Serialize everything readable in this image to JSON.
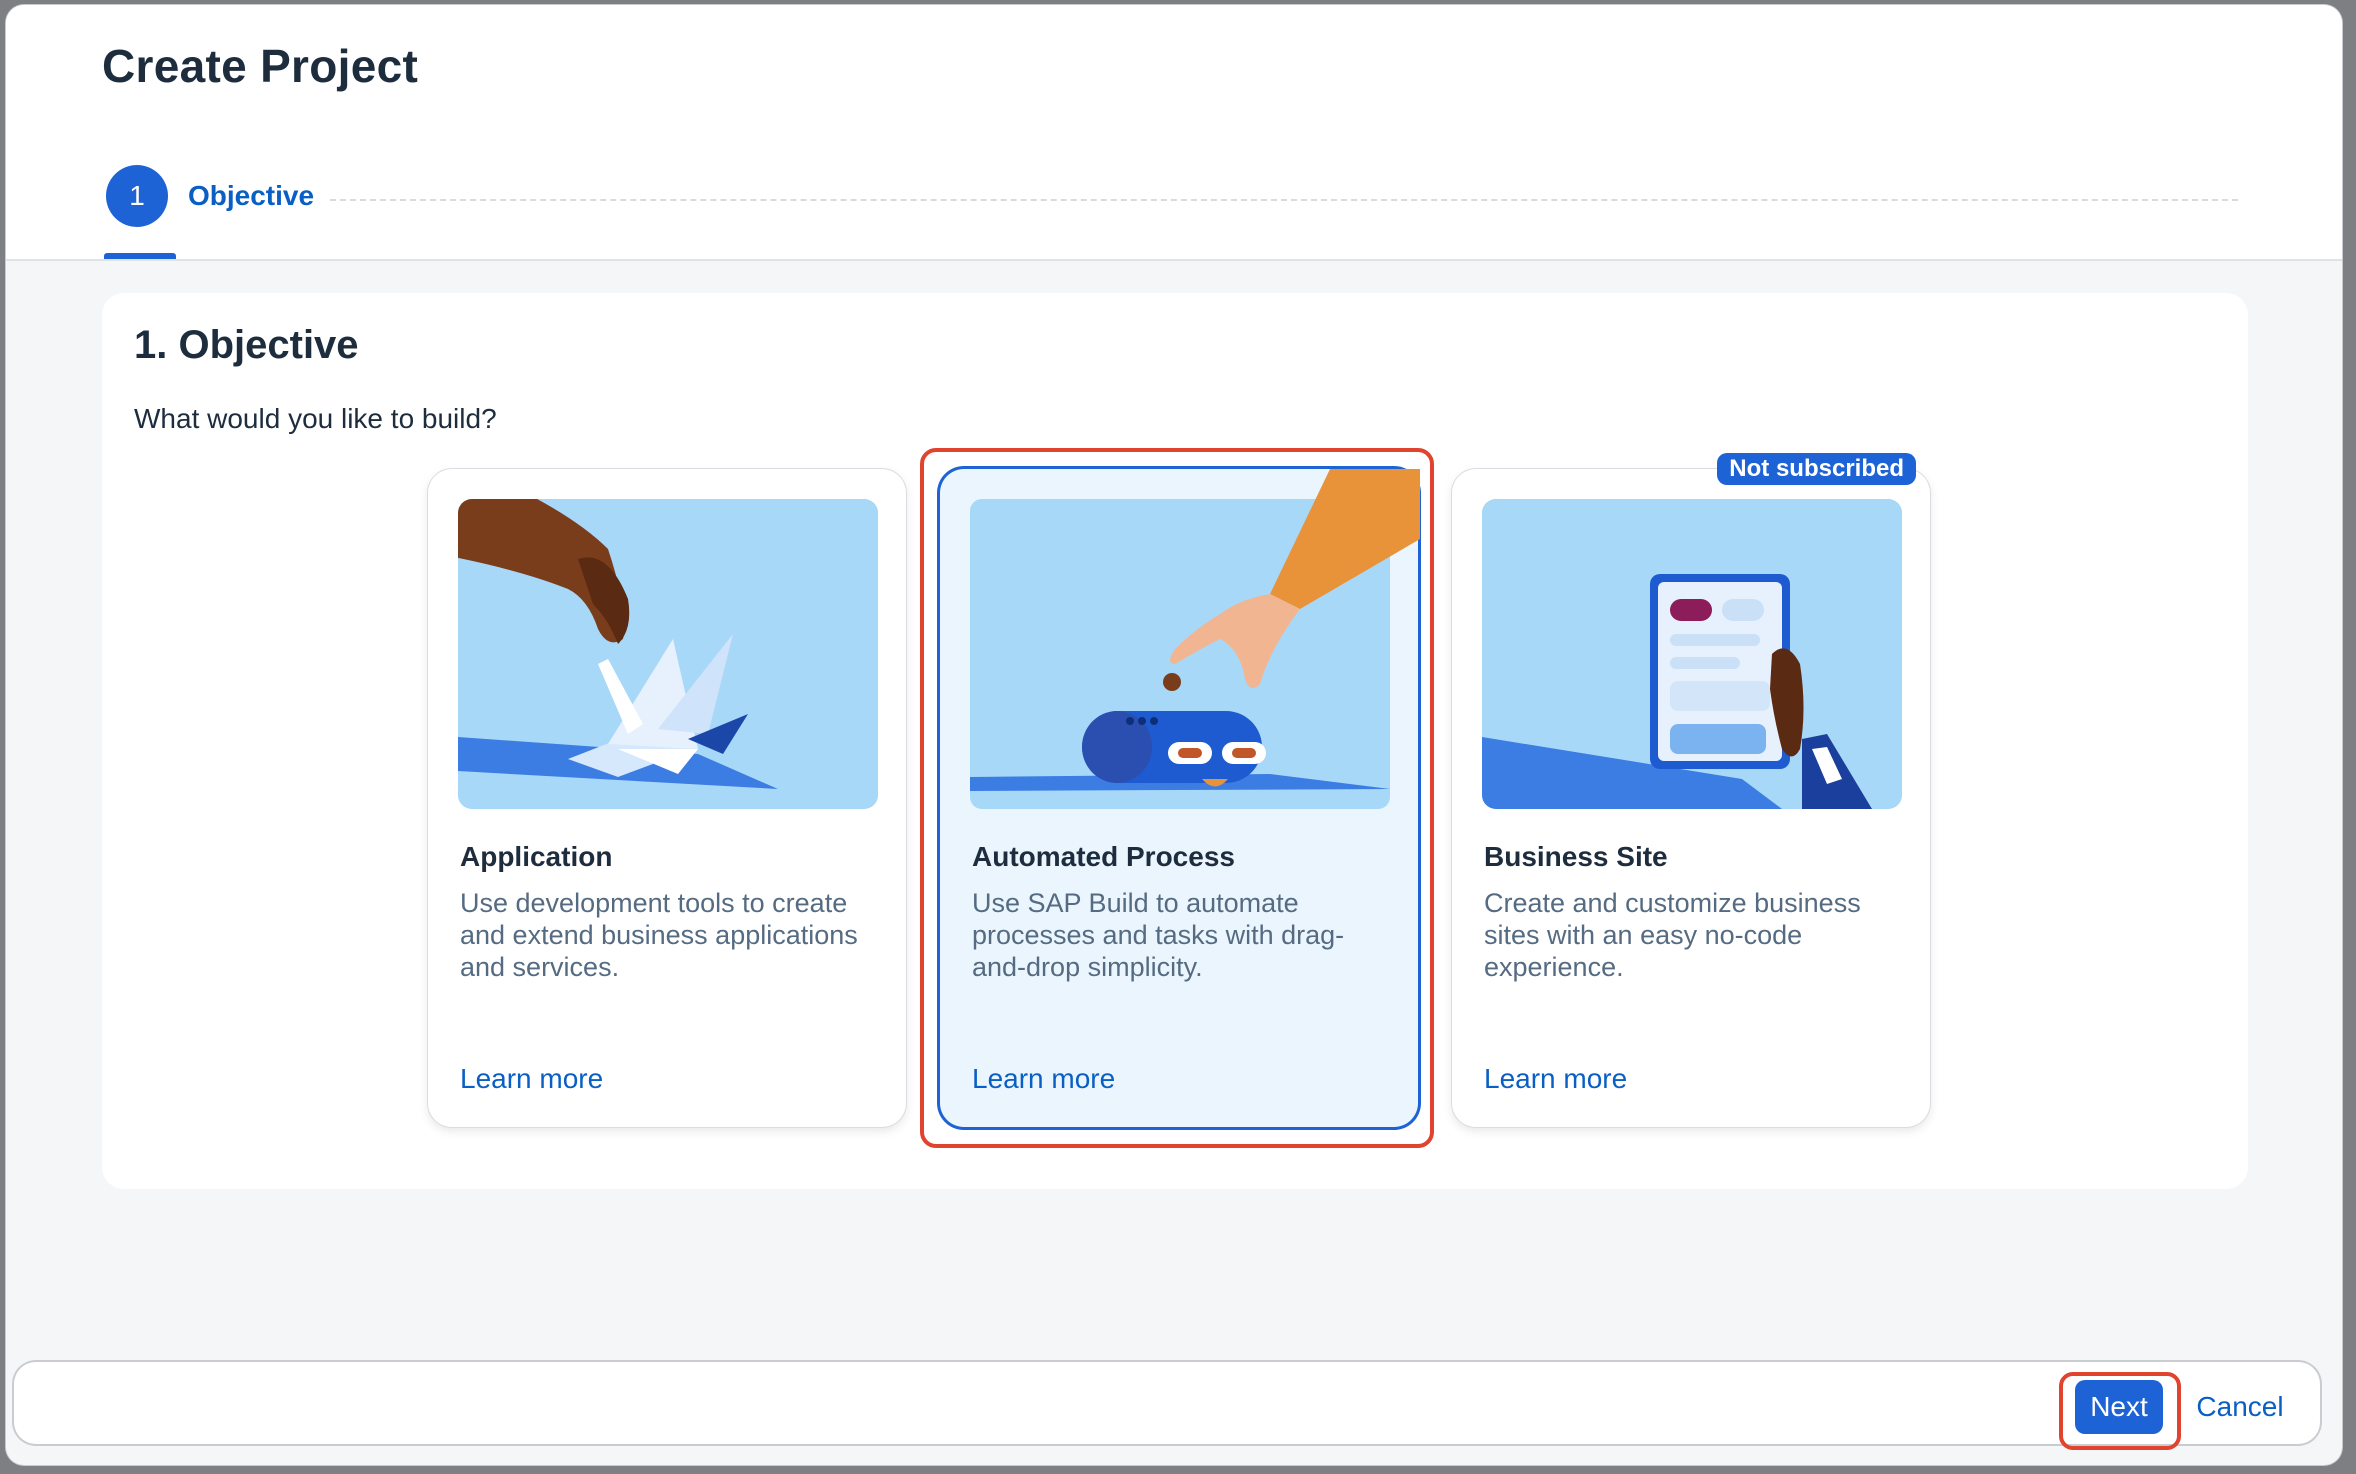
{
  "dialog": {
    "title": "Create Project"
  },
  "wizard": {
    "steps": [
      {
        "number": "1",
        "label": "Objective"
      }
    ]
  },
  "section": {
    "title": "1. Objective",
    "question": "What would you like to build?"
  },
  "cards": [
    {
      "title": "Application",
      "description": "Use development tools to create and extend business applications and services.",
      "link": "Learn more",
      "illustration": "hand-folding-paper-crane"
    },
    {
      "title": "Automated Process",
      "description": "Use SAP Build to automate processes and tasks with drag-and-drop simplicity.",
      "link": "Learn more",
      "illustration": "hand-with-robot",
      "selected": true
    },
    {
      "title": "Business Site",
      "description": "Create and customize business sites with an easy no-code experience.",
      "link": "Learn more",
      "illustration": "hand-holding-tablet",
      "badge": "Not subscribed"
    }
  ],
  "footer": {
    "next_label": "Next",
    "cancel_label": "Cancel"
  },
  "colors": {
    "accent": "#1e63d6",
    "link": "#0a5fc4",
    "highlight": "#e0432e",
    "selected_card_bg": "#ebf5fe"
  }
}
